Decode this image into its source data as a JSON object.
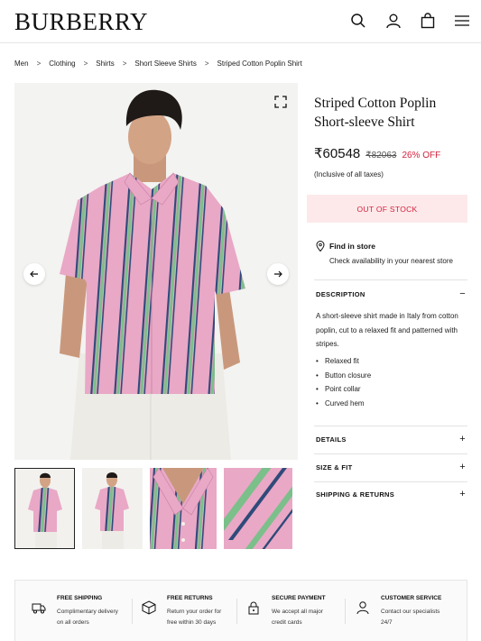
{
  "header": {
    "logo": "BURBERRY"
  },
  "breadcrumb": [
    "Men",
    "Clothing",
    "Shirts",
    "Short Sleeve Shirts",
    "Striped Cotton Poplin Shirt"
  ],
  "breadcrumb_sep": ">",
  "product": {
    "title_line1": "Striped Cotton Poplin",
    "title_line2": "Short-sleeve Shirt",
    "price": "₹60548",
    "original_price": "₹82063",
    "discount": "26% OFF",
    "tax_note": "(Inclusive of all taxes)",
    "stock_status": "OUT OF STOCK",
    "find_store_title": "Find in store",
    "find_store_sub": "Check availability in your nearest store"
  },
  "sections": {
    "description": {
      "label": "DESCRIPTION",
      "toggle": "−"
    },
    "details": {
      "label": "DETAILS",
      "toggle": "+"
    },
    "size_fit": {
      "label": "SIZE & FIT",
      "toggle": "+"
    },
    "shipping": {
      "label": "SHIPPING & RETURNS",
      "toggle": "+"
    }
  },
  "description_text": "A short-sleeve shirt made in Italy from cotton poplin, cut to a relaxed fit and patterned with stripes.",
  "bullets": [
    "Relaxed fit",
    "Button closure",
    "Point collar",
    "Curved hem"
  ],
  "features": [
    {
      "title": "FREE SHIPPING",
      "line1": "Complimentary delivery",
      "line2": "on all orders",
      "icon": "truck-icon"
    },
    {
      "title": "FREE RETURNS",
      "line1": "Return your order for",
      "line2": "free within 30 days",
      "icon": "box-icon"
    },
    {
      "title": "SECURE PAYMENT",
      "line1": "We accept all major",
      "line2": "credit cards",
      "icon": "lock-icon"
    },
    {
      "title": "CUSTOMER SERVICE",
      "line1": "Contact our specialists",
      "line2": "24/7",
      "icon": "user-icon"
    }
  ],
  "colors": {
    "accent_red": "#d4213d",
    "oos_bg": "#fde9ea",
    "shirt_pink": "#e9a8c6",
    "stripe_green": "#7bbf8a",
    "stripe_navy": "#2f4a7a"
  }
}
